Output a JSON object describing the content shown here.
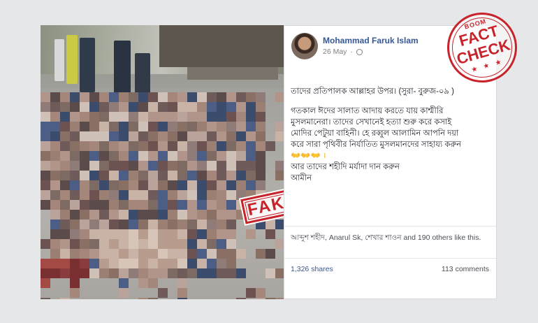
{
  "post": {
    "author": "Mohammad Faruk Islam",
    "date": "26 May",
    "privacy_separator": "·",
    "text_lines_p1": [
      "তাদের প্রতিপালক আল্লাহর উপর। (সুরা- বুরুজ-০৯ )"
    ],
    "text_lines_p2": [
      "গতকাল ঈদের সালাত আদায় করতে যায় কাশ্মীরি",
      "মুসলমানেরা। তাদের সেখানেই হত্যা শুরু করে কসাই",
      "মোদির পেটুয়া বাহিনী। হে রব্বুল আলামিন আপনি দয়া",
      "করে সারা পৃথিবীর নির্যাতিত মুসলমানদের সাহায্য করুন"
    ],
    "emoji_line": "👐👐👐 ।",
    "text_lines_p3": [
      "আর তাদের শহীদি মর্যাদা দান করুন",
      "আমীন"
    ],
    "likes": "আব্দুশ শহীদ, Anarul Sk, শেখার শাওন and 190 others like this.",
    "shares": "1,326 shares",
    "comments": "113 comments"
  },
  "stamp": {
    "label": "FAKE",
    "color": "#c8232a"
  },
  "badge": {
    "brand": "BOOM",
    "line1": "FACT",
    "line2": "CHECK",
    "stars": "★ ★ ★",
    "color": "#c8232a"
  },
  "colors": {
    "link": "#365899",
    "background": "#e6e7e9"
  }
}
